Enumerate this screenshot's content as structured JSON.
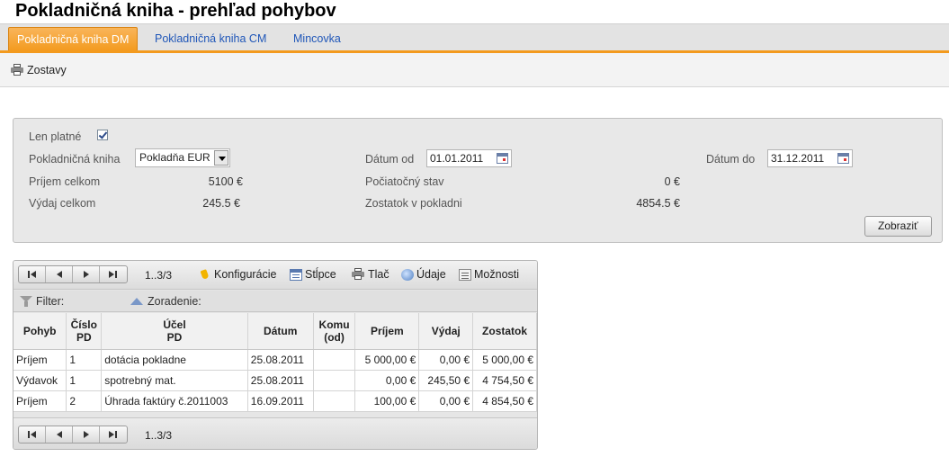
{
  "page": {
    "title": "Pokladničná kniha - prehľad pohybov"
  },
  "tabs": [
    {
      "label": "Pokladničná kniha DM",
      "active": true
    },
    {
      "label": "Pokladničná kniha CM",
      "active": false
    },
    {
      "label": "Mincovka",
      "active": false
    }
  ],
  "colors": {
    "accent": "#f39a1e",
    "link": "#1f56b8"
  },
  "toolbar": {
    "reports_label": "Zostavy",
    "reports_icon": "printer-icon"
  },
  "filter": {
    "only_valid_label": "Len platné",
    "only_valid_checked": true,
    "cashbook_label": "Pokladničná kniha",
    "cashbook_value": "Pokladňa EUR",
    "date_from_label": "Dátum od",
    "date_from_value": "01.01.2011",
    "date_to_label": "Dátum do",
    "date_to_value": "31.12.2011",
    "income_total_label": "Príjem celkom",
    "income_total_value": "5100 €",
    "initial_state_label": "Počiatočný stav",
    "initial_state_value": "0 €",
    "expense_total_label": "Výdaj celkom",
    "expense_total_value": "245.5 €",
    "balance_label": "Zostatok v pokladni",
    "balance_value": "4854.5 €",
    "show_button": "Zobraziť"
  },
  "grid": {
    "pager_info": "1..3/3",
    "footer_pager_info": "1..3/3",
    "tools": {
      "config": "Konfigurácie",
      "columns": "Stĺpce",
      "print": "Tlač",
      "data": "Údaje",
      "options": "Možnosti"
    },
    "filter_label": "Filter:",
    "sort_label": "Zoradenie:",
    "headers": {
      "pohyb": "Pohyb",
      "cislo_1": "Číslo",
      "cislo_2": "PD",
      "ucel_1": "Účel",
      "ucel_2": "PD",
      "datum": "Dátum",
      "komu_1": "Komu",
      "komu_2": "(od)",
      "prijem": "Príjem",
      "vydaj": "Výdaj",
      "zostatok": "Zostatok"
    },
    "rows": [
      {
        "pohyb": "Príjem",
        "cislo": "1",
        "ucel": "dotácia pokladne",
        "datum": "25.08.2011",
        "komu": "",
        "prijem": "5 000,00 €",
        "vydaj": "0,00 €",
        "zostatok": "5 000,00 €"
      },
      {
        "pohyb": "Výdavok",
        "cislo": "1",
        "ucel": "spotrebný mat.",
        "datum": "25.08.2011",
        "komu": "",
        "prijem": "0,00 €",
        "vydaj": "245,50 €",
        "zostatok": "4 754,50 €"
      },
      {
        "pohyb": "Príjem",
        "cislo": "2",
        "ucel": "Úhrada faktúry č.2011003",
        "datum": "16.09.2011",
        "komu": "",
        "prijem": "100,00 €",
        "vydaj": "0,00 €",
        "zostatok": "4 854,50 €"
      }
    ]
  }
}
